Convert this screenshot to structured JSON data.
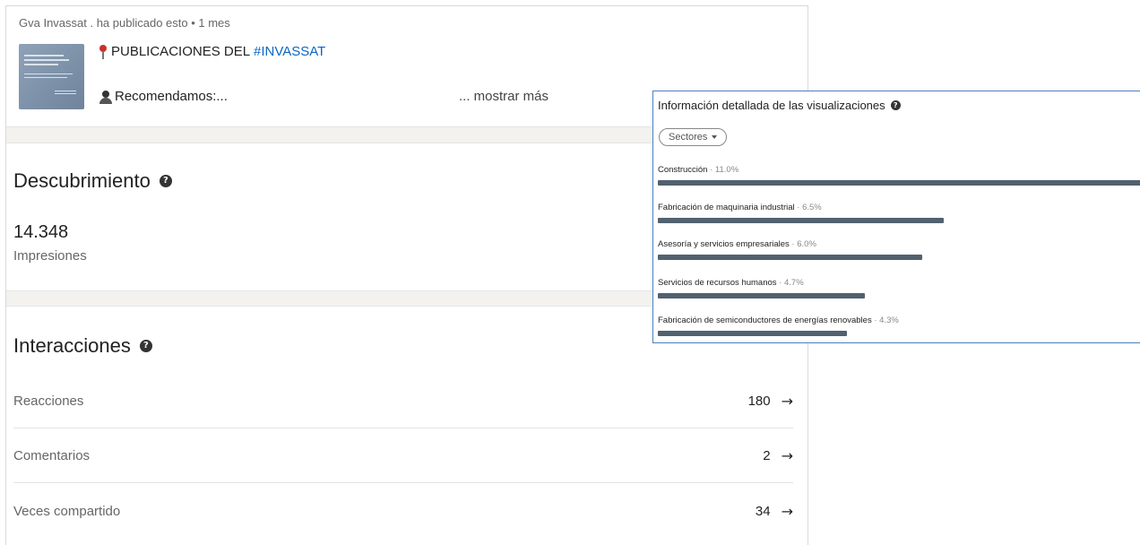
{
  "post": {
    "meta": "Gva Invassat . ha publicado esto • 1 mes",
    "title_prefix": "PUBLICACIONES DEL ",
    "title_hashtag": "#INVASSAT",
    "line2": "Recomendamos:...",
    "show_more": "... mostrar más"
  },
  "discovery": {
    "title": "Descubrimiento",
    "impressions_value": "14.348",
    "impressions_label": "Impresiones"
  },
  "interactions": {
    "title": "Interacciones",
    "rows": [
      {
        "label": "Reacciones",
        "value": "180"
      },
      {
        "label": "Comentarios",
        "value": "2"
      },
      {
        "label": "Veces compartido",
        "value": "34"
      }
    ]
  },
  "breakdown": {
    "title": "Información detallada de las visualizaciones",
    "filter": "Sectores",
    "items": [
      {
        "label": "Construcción",
        "pct": "11.0%",
        "value": 11.0
      },
      {
        "label": "Fabricación de maquinaria industrial",
        "pct": "6.5%",
        "value": 6.5
      },
      {
        "label": "Asesoría y servicios empresariales",
        "pct": "6.0%",
        "value": 6.0
      },
      {
        "label": "Servicios de recursos humanos",
        "pct": "4.7%",
        "value": 4.7
      },
      {
        "label": "Fabricación de semiconductores de energías renovables",
        "pct": "4.3%",
        "value": 4.3
      }
    ]
  },
  "icons": {
    "help": "help-circle-icon",
    "arrow": "arrow-right-icon",
    "pin": "pushpin-icon",
    "person": "person-icon",
    "caret": "caret-down-icon"
  }
}
